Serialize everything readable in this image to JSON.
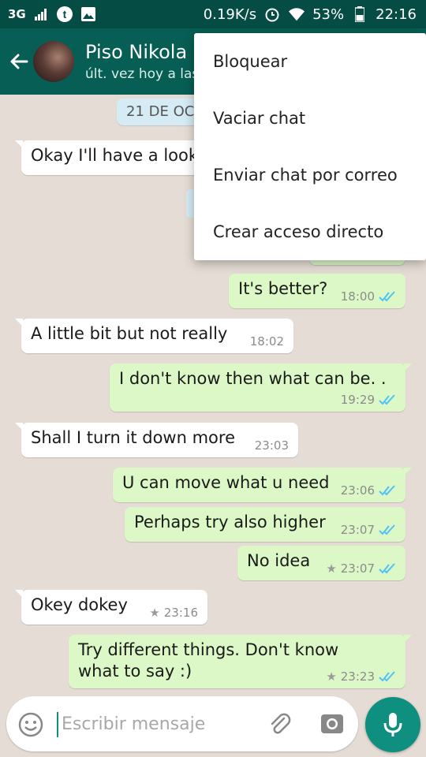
{
  "status_bar": {
    "network": "3G",
    "speed": "0.19K/s",
    "battery": "53%",
    "time": "22:16",
    "icons": [
      "signal-icon",
      "tumblr-icon",
      "image-icon",
      "alarm-icon",
      "wifi-icon",
      "battery-icon"
    ]
  },
  "header": {
    "name": "Piso Nikola",
    "status": "últ. vez hoy a las"
  },
  "date_chip": "21 DE OCT",
  "messages": [
    {
      "dir": "in",
      "text": "Okay I'll have a look",
      "time": "",
      "ticks": false,
      "star": false
    },
    {
      "dir": "out",
      "text": "It's better?",
      "time": "18:00",
      "ticks": true,
      "star": false
    },
    {
      "dir": "in",
      "text": "A little bit but not really",
      "time": "18:02",
      "ticks": false,
      "star": false
    },
    {
      "dir": "out",
      "text": "I don't know then what can be.  .",
      "time": "19:29",
      "ticks": true,
      "star": false
    },
    {
      "dir": "in",
      "text": "Shall I turn it down more",
      "time": "23:03",
      "ticks": false,
      "star": false
    },
    {
      "dir": "out",
      "text": "U can move what u need",
      "time": "23:06",
      "ticks": true,
      "star": false
    },
    {
      "dir": "out",
      "text": "Perhaps try also higher",
      "time": "23:07",
      "ticks": true,
      "star": false
    },
    {
      "dir": "out",
      "text": "No idea",
      "time": "23:07",
      "ticks": true,
      "star": true
    },
    {
      "dir": "in",
      "text": "Okey dokey",
      "time": "23:16",
      "ticks": false,
      "star": true
    },
    {
      "dir": "out",
      "text_line1": "Try different things. Don't know",
      "text_line2": "what to say :)",
      "time": "23:23",
      "ticks": true,
      "star": true
    }
  ],
  "menu": {
    "items": [
      "Bloquear",
      "Vaciar chat",
      "Enviar chat por correo",
      "Crear acceso directo"
    ]
  },
  "composer": {
    "placeholder": "Escribir mensaje"
  },
  "colors": {
    "header": "#075e54",
    "status_bar": "#054d44",
    "outgoing_bubble": "#dcf8c6",
    "incoming_bubble": "#ffffff",
    "accent": "#0f8f80",
    "ticks": "#4fc3f7"
  }
}
